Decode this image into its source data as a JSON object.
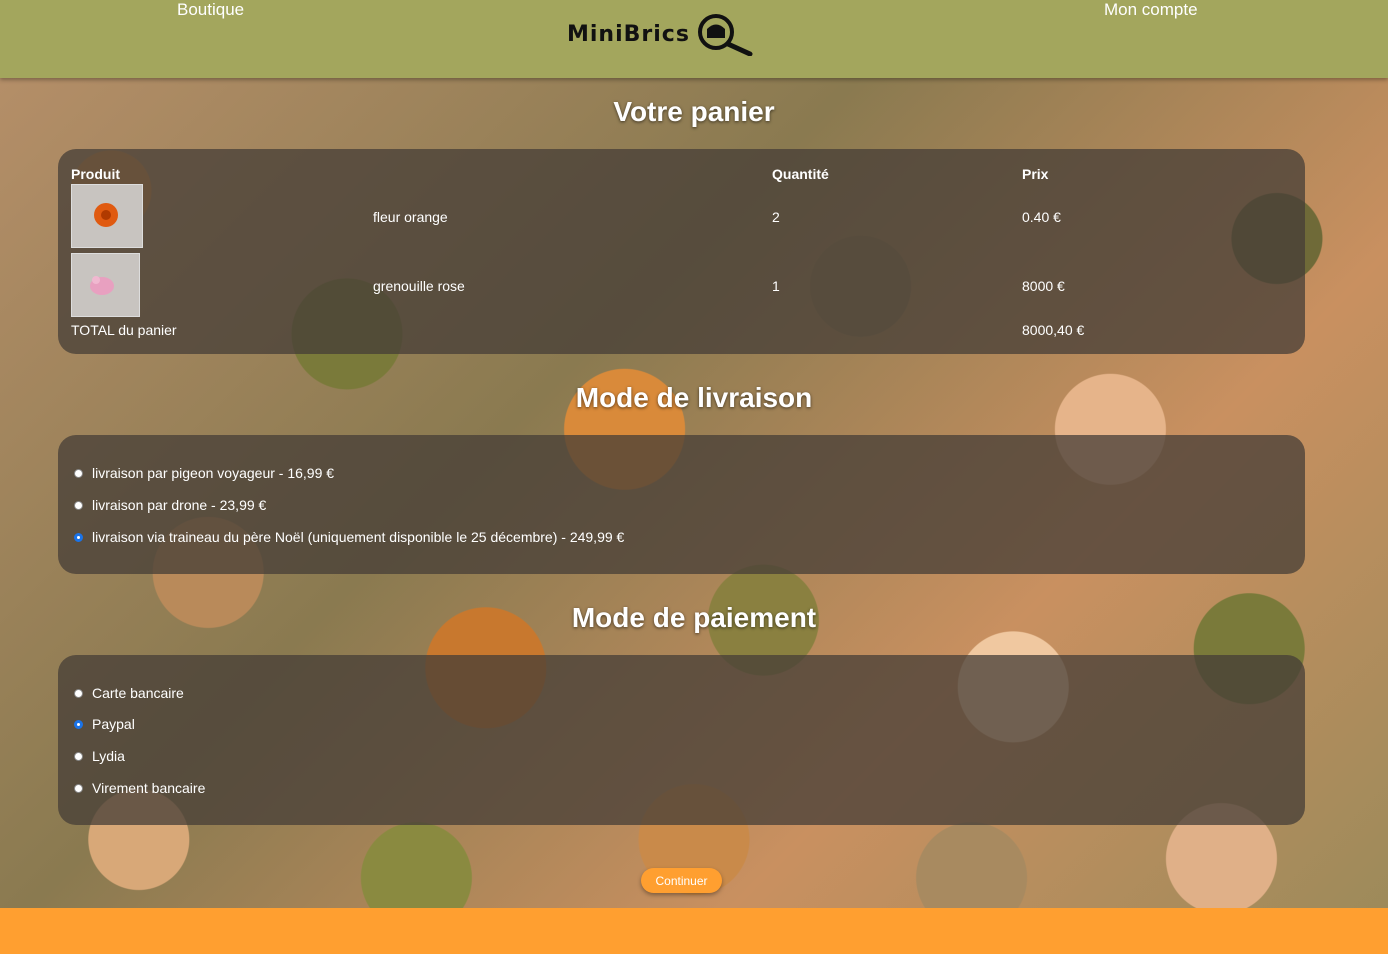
{
  "header": {
    "nav_left": "Boutique",
    "nav_right": "Mon compte",
    "logo_text": "MiniBrics"
  },
  "cart": {
    "title": "Votre panier",
    "columns": {
      "product": "Produit",
      "quantity": "Quantité",
      "price": "Prix"
    },
    "rows": [
      {
        "name": "fleur orange",
        "quantity": "2",
        "price": "0.40 €"
      },
      {
        "name": "grenouille rose",
        "quantity": "1",
        "price": "8000 €"
      }
    ],
    "total_label": "TOTAL du panier",
    "total_value": "8000,40 €"
  },
  "delivery": {
    "title": "Mode de livraison",
    "options": [
      {
        "label": "livraison par pigeon voyageur - 16,99 €",
        "checked": false
      },
      {
        "label": "livraison par drone - 23,99 €",
        "checked": false
      },
      {
        "label": "livraison via traineau du père Noël (uniquement disponible le 25 décembre) - 249,99 €",
        "checked": true
      }
    ]
  },
  "payment": {
    "title": "Mode de paiement",
    "options": [
      {
        "label": "Carte bancaire",
        "checked": false
      },
      {
        "label": "Paypal",
        "checked": true
      },
      {
        "label": "Lydia",
        "checked": false
      },
      {
        "label": "Virement bancaire",
        "checked": false
      }
    ]
  },
  "continue_label": "Continuer",
  "colors": {
    "header": "#a3a65d",
    "accent": "#ff9f30",
    "radio_checked": "#1a73e8"
  }
}
